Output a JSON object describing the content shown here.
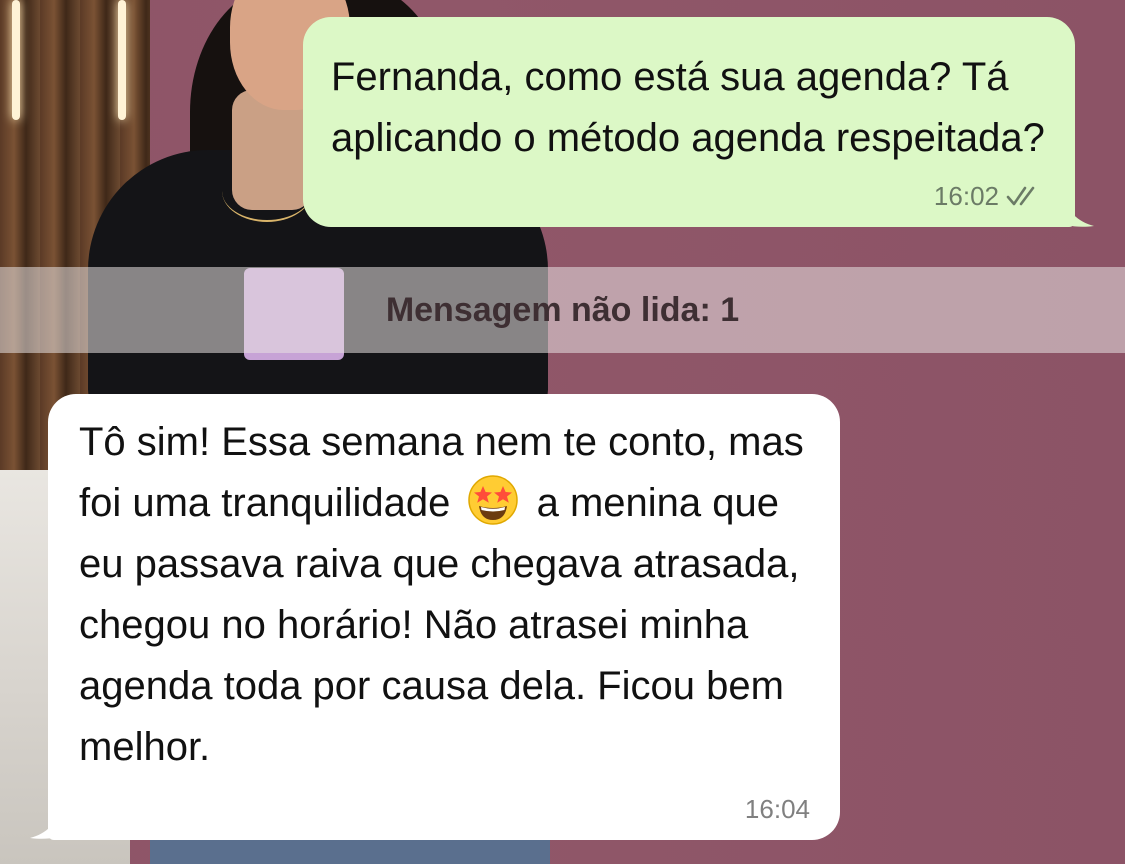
{
  "chat": {
    "outgoing": {
      "text": "Fernanda, como está sua agenda? Tá aplicando o método agenda respeitada?",
      "time": "16:02",
      "status_icon": "double-check-icon"
    },
    "unread_divider": {
      "label": "Mensagem não lida: 1"
    },
    "incoming": {
      "text_before_emoji": "Tô sim! Essa semana nem te conto, mas foi uma tranquilidade",
      "emoji": "star-struck-emoji",
      "text_after_emoji": "a menina que eu passava raiva que chegava atrasada, chegou no horário! Não atrasei minha agenda toda por causa dela. Ficou bem melhor.",
      "time": "16:04"
    }
  },
  "colors": {
    "outgoing_bubble": "#dcf8c6",
    "incoming_bubble": "#ffffff",
    "wallpaper": "#8e5468"
  }
}
